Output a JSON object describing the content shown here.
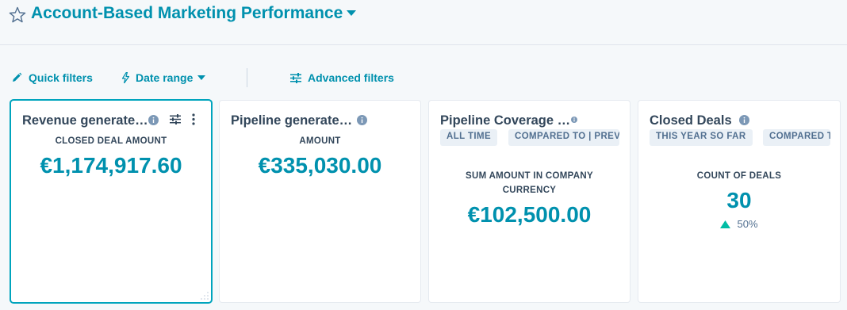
{
  "header": {
    "title": "Account-Based Marketing Performance",
    "star_icon": "star-outline-icon",
    "caret_icon": "caret-down-icon"
  },
  "filters": {
    "quick_filters": "Quick filters",
    "date_range": "Date range",
    "advanced_filters": "Advanced filters"
  },
  "cards": [
    {
      "title": "Revenue generate…",
      "metric_label": "CLOSED DEAL AMOUNT",
      "value": "€1,174,917.60",
      "selected": true
    },
    {
      "title": "Pipeline generate…",
      "metric_label": "AMOUNT",
      "value": "€335,030.00"
    },
    {
      "title": "Pipeline Coverage …",
      "tags": [
        "ALL TIME",
        "COMPARED TO | PREV"
      ],
      "metric_label_line1": "SUM AMOUNT IN COMPANY",
      "metric_label_line2": "CURRENCY",
      "value": "€102,500.00"
    },
    {
      "title": "Closed Deals",
      "tags": [
        "THIS YEAR SO FAR",
        "COMPARED T"
      ],
      "metric_label": "COUNT OF DEALS",
      "value": "30",
      "change": "50%",
      "change_direction": "up"
    }
  ],
  "colors": {
    "accent": "#0091ae",
    "text": "#33475b",
    "selected_border": "#00a4bd",
    "positive": "#00bda5"
  }
}
